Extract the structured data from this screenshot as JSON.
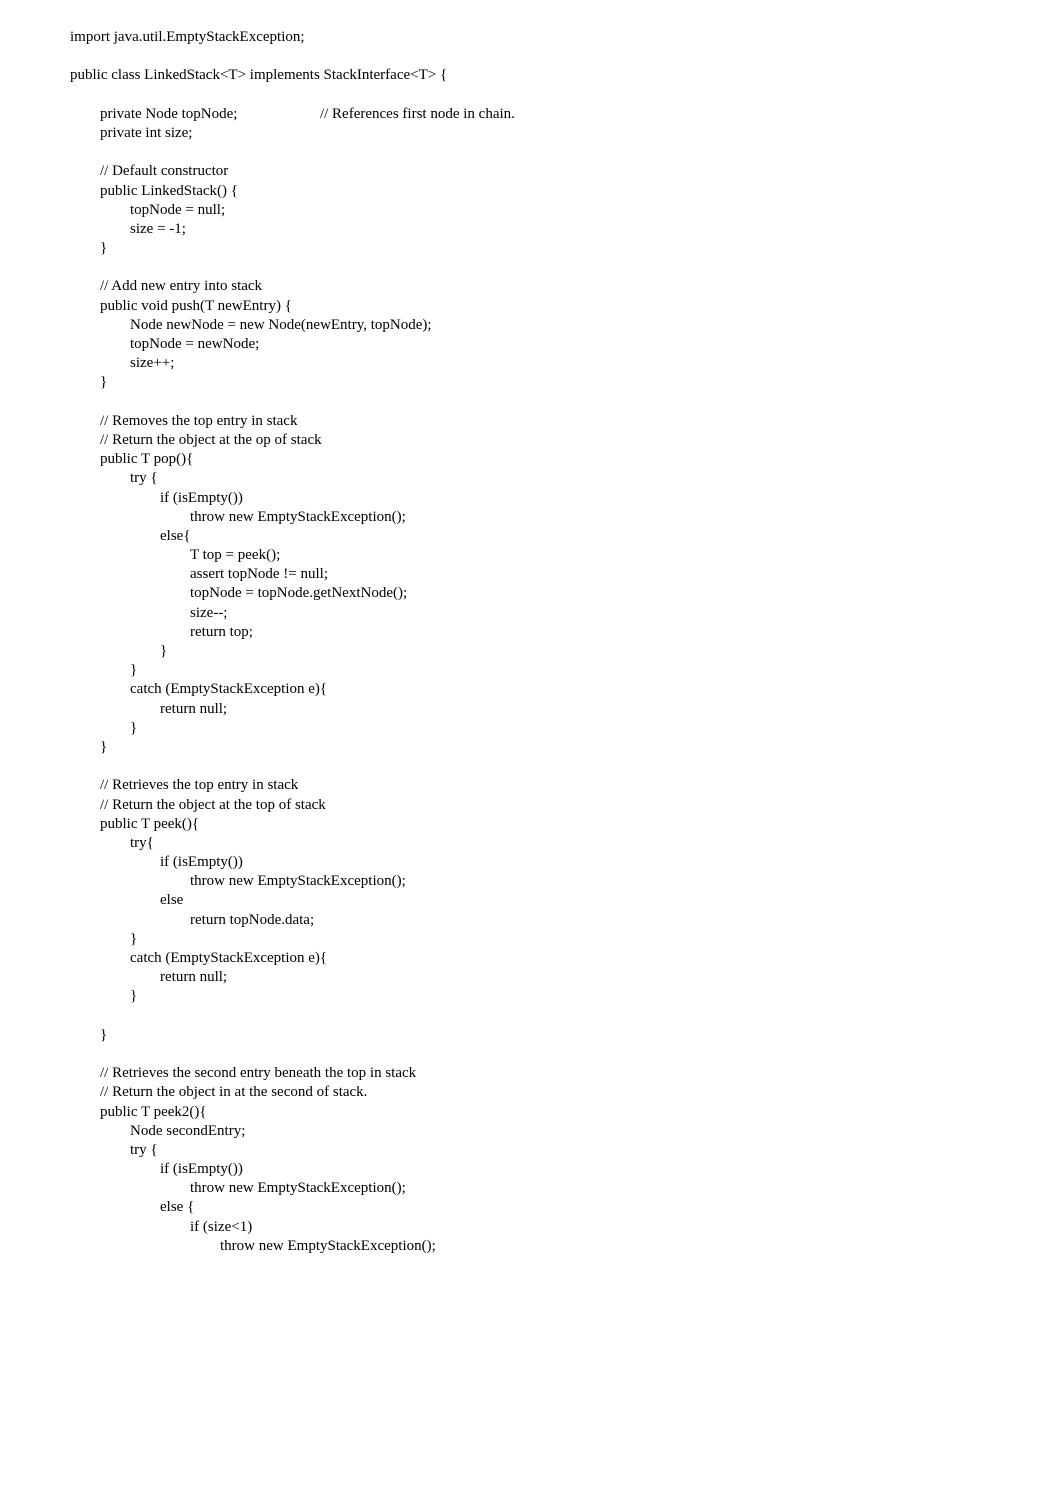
{
  "code_lines": [
    "import java.util.EmptyStackException;",
    "",
    "public class LinkedStack<T> implements StackInterface<T> {",
    "",
    "\tprivate Node topNode;                      // References first node in chain.",
    "\tprivate int size;",
    "",
    "\t// Default constructor",
    "\tpublic LinkedStack() {",
    "\t\ttopNode = null;",
    "\t\tsize = -1;",
    "\t}",
    "",
    "\t// Add new entry into stack",
    "\tpublic void push(T newEntry) {",
    "\t\tNode newNode = new Node(newEntry, topNode);",
    "\t\ttopNode = newNode;",
    "\t\tsize++;",
    "\t}",
    "",
    "\t// Removes the top entry in stack",
    "\t// Return the object at the op of stack",
    "\tpublic T pop(){",
    "\t\ttry {",
    "\t\t\tif (isEmpty())",
    "\t\t\t\tthrow new EmptyStackException();",
    "\t\t\telse{",
    "\t\t\t\tT top = peek();",
    "\t\t\t\tassert topNode != null;",
    "\t\t\t\ttopNode = topNode.getNextNode();",
    "\t\t\t\tsize--;",
    "\t\t\t\treturn top;",
    "\t\t\t}",
    "\t\t}",
    "\t\tcatch (EmptyStackException e){",
    "\t\t\treturn null;",
    "\t\t}",
    "\t}",
    "",
    "\t// Retrieves the top entry in stack",
    "\t// Return the object at the top of stack",
    "\tpublic T peek(){",
    "\t\ttry{",
    "\t\t\tif (isEmpty())",
    "\t\t\t\tthrow new EmptyStackException();",
    "\t\t\telse",
    "\t\t\t\treturn topNode.data;",
    "\t\t}",
    "\t\tcatch (EmptyStackException e){",
    "\t\t\treturn null;",
    "\t\t}",
    "",
    "\t}",
    "",
    "\t// Retrieves the second entry beneath the top in stack",
    "\t// Return the object in at the second of stack.",
    "\tpublic T peek2(){",
    "\t\tNode secondEntry;",
    "\t\ttry {",
    "\t\t\tif (isEmpty())",
    "\t\t\t\tthrow new EmptyStackException();",
    "\t\t\telse {",
    "\t\t\t\tif (size<1)",
    "\t\t\t\t\tthrow new EmptyStackException();"
  ]
}
